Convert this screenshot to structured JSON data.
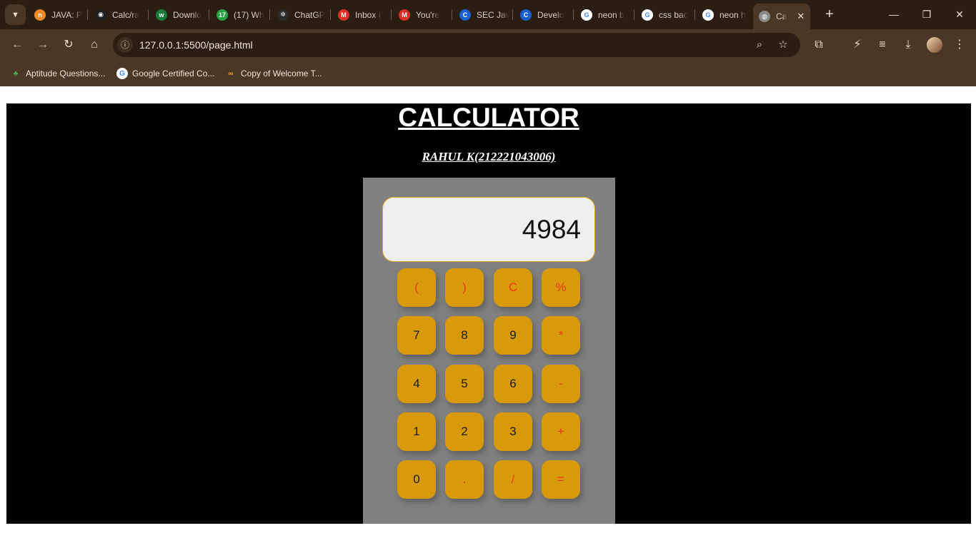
{
  "browser": {
    "tabs": [
      {
        "label": "JAVA: P",
        "icon": "naukri-icon",
        "color": "#f08a24",
        "glyph": "n"
      },
      {
        "label": "Calc/ra",
        "icon": "github-icon",
        "color": "#1f1f1f",
        "glyph": "◉"
      },
      {
        "label": "Downlo",
        "icon": "w-icon",
        "color": "#1b7a3a",
        "glyph": "w"
      },
      {
        "label": "(17) Wh",
        "icon": "whatsapp-icon",
        "color": "#25a244",
        "glyph": "17"
      },
      {
        "label": "ChatGP",
        "icon": "chatgpt-icon",
        "color": "#2b2b2b",
        "glyph": "✲"
      },
      {
        "label": "Inbox (",
        "icon": "gmail-icon",
        "color": "#d93025",
        "glyph": "M"
      },
      {
        "label": "You're",
        "icon": "gmail-icon",
        "color": "#d93025",
        "glyph": "M"
      },
      {
        "label": "SEC Jav",
        "icon": "c-icon",
        "color": "#1a5fd0",
        "glyph": "C"
      },
      {
        "label": "Develo",
        "icon": "c-icon",
        "color": "#1a5fd0",
        "glyph": "C"
      },
      {
        "label": "neon b",
        "icon": "google-icon",
        "color": "#ffffff",
        "glyph": "G"
      },
      {
        "label": "css bac",
        "icon": "google-icon",
        "color": "#ffffff",
        "glyph": "G"
      },
      {
        "label": "neon h",
        "icon": "google-icon",
        "color": "#ffffff",
        "glyph": "G"
      },
      {
        "label": "Ca",
        "icon": "globe-icon",
        "color": "#8a8a8a",
        "glyph": "◍",
        "active": true
      }
    ],
    "url": "127.0.0.1:5500/page.html",
    "bookmarks": [
      {
        "label": "Aptitude Questions...",
        "icon": "aptitude-icon",
        "color": "#4caf50",
        "glyph": "♣"
      },
      {
        "label": "Google Certified Co...",
        "icon": "google-icon",
        "color": "#ffffff",
        "glyph": "G"
      },
      {
        "label": "Copy of Welcome T...",
        "icon": "colab-icon",
        "color": "#f4a024",
        "glyph": "∞"
      }
    ]
  },
  "page": {
    "title": "CALCULATOR",
    "author": "RAHUL K(212221043006)",
    "display_value": "4984",
    "keys": [
      {
        "label": "(",
        "type": "op",
        "name": "open-paren-button"
      },
      {
        "label": ")",
        "type": "op",
        "name": "close-paren-button"
      },
      {
        "label": "C",
        "type": "op",
        "name": "clear-button"
      },
      {
        "label": "%",
        "type": "op",
        "name": "percent-button"
      },
      {
        "label": "7",
        "type": "num",
        "name": "digit-7-button"
      },
      {
        "label": "8",
        "type": "num",
        "name": "digit-8-button"
      },
      {
        "label": "9",
        "type": "num",
        "name": "digit-9-button"
      },
      {
        "label": "*",
        "type": "op",
        "name": "multiply-button"
      },
      {
        "label": "4",
        "type": "num",
        "name": "digit-4-button"
      },
      {
        "label": "5",
        "type": "num",
        "name": "digit-5-button"
      },
      {
        "label": "6",
        "type": "num",
        "name": "digit-6-button"
      },
      {
        "label": "-",
        "type": "op",
        "name": "subtract-button"
      },
      {
        "label": "1",
        "type": "num",
        "name": "digit-1-button"
      },
      {
        "label": "2",
        "type": "num",
        "name": "digit-2-button"
      },
      {
        "label": "3",
        "type": "num",
        "name": "digit-3-button"
      },
      {
        "label": "+",
        "type": "op",
        "name": "add-button"
      },
      {
        "label": "0",
        "type": "num",
        "name": "digit-0-button"
      },
      {
        "label": ".",
        "type": "op",
        "name": "decimal-button"
      },
      {
        "label": "/",
        "type": "op",
        "name": "divide-button"
      },
      {
        "label": "=",
        "type": "op",
        "name": "equals-button"
      }
    ]
  },
  "colors": {
    "key_bg": "#d89a0a",
    "operator_text": "#e8361a",
    "calculator_bg": "#808080",
    "stage_bg": "#000000"
  }
}
